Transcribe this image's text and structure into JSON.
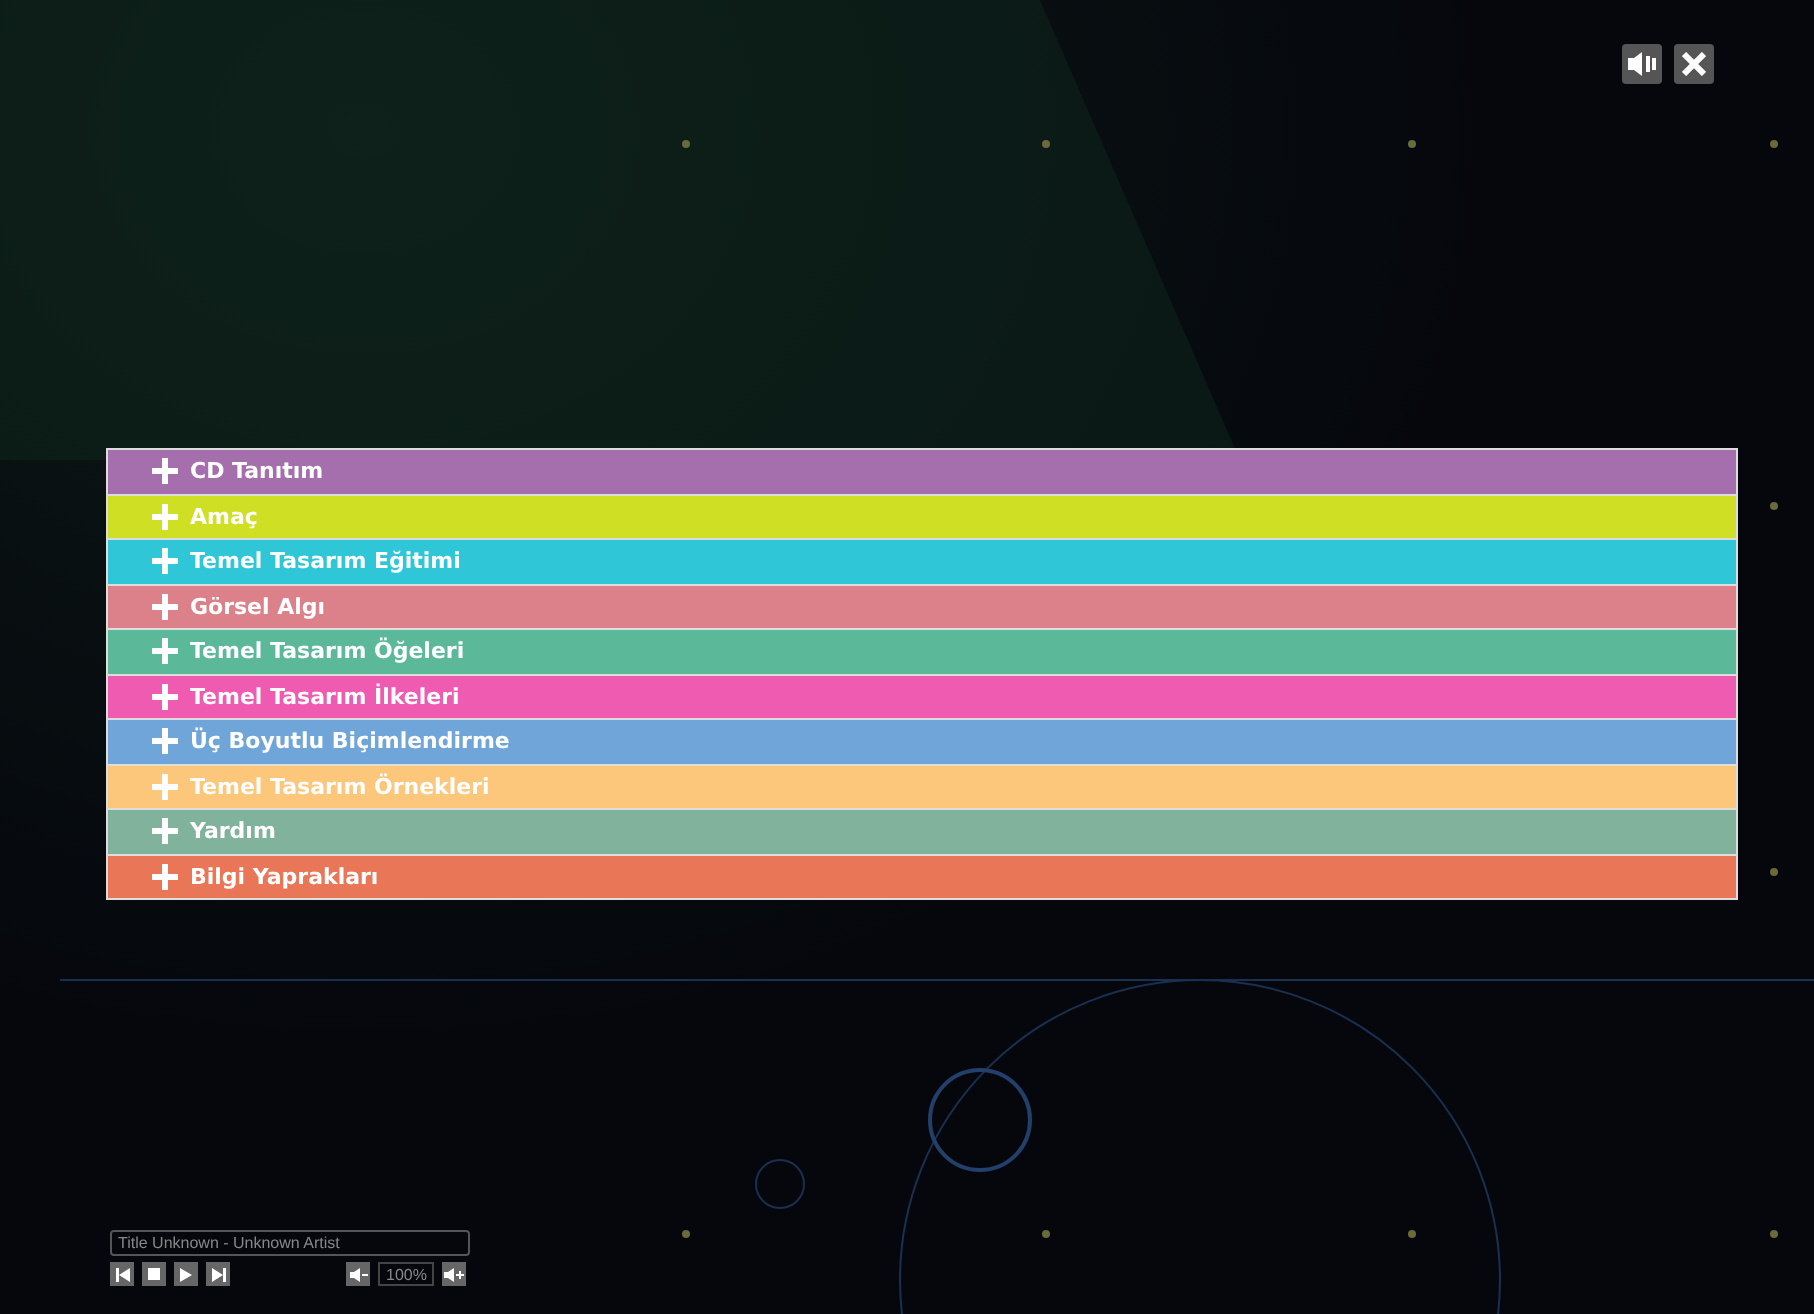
{
  "menu": [
    {
      "label": "CD Tanıtım",
      "color": "#a56fae"
    },
    {
      "label": "Amaç",
      "color": "#cfe024"
    },
    {
      "label": "Temel Tasarım Eğitimi",
      "color": "#2fc6d8"
    },
    {
      "label": "Görsel Algı",
      "color": "#dc8189"
    },
    {
      "label": "Temel Tasarım Öğeleri",
      "color": "#5bb99a"
    },
    {
      "label": "Temel Tasarım İlkeleri",
      "color": "#ef5bb1"
    },
    {
      "label": "Üç Boyutlu Biçimlendirme",
      "color": "#70a5d9"
    },
    {
      "label": "Temel Tasarım Örnekleri",
      "color": "#fcc77a"
    },
    {
      "label": "Yardım",
      "color": "#81b29b"
    },
    {
      "label": "Bilgi Yaprakları",
      "color": "#ea7658"
    }
  ],
  "player": {
    "track": "Title Unknown  -  Unknown Artist",
    "volume": "100%"
  }
}
